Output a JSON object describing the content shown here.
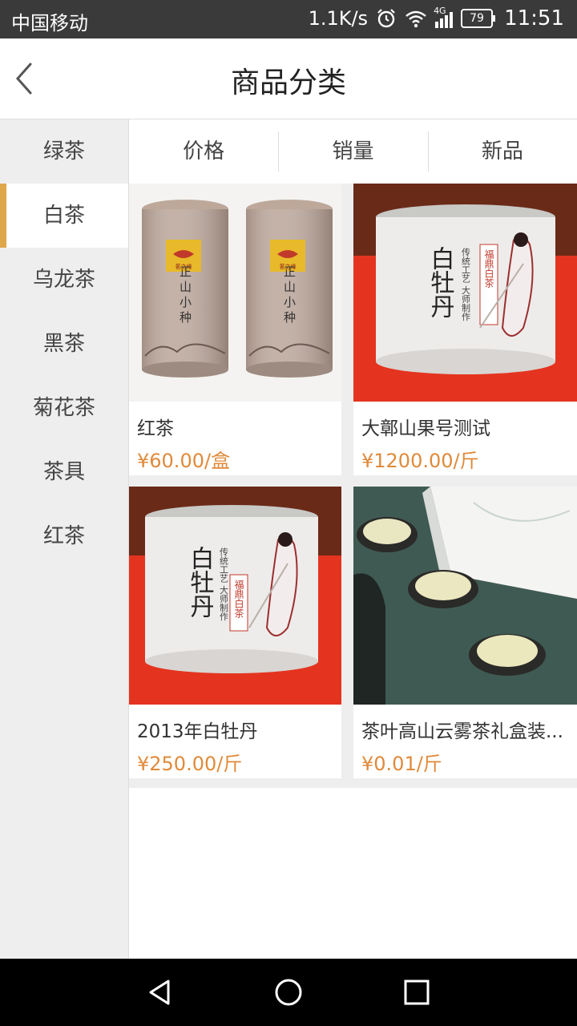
{
  "status_bar": {
    "carrier": "中国移动",
    "speed": "1.1K/s",
    "network": "4G",
    "battery": "79",
    "time": "11:51"
  },
  "header": {
    "title": "商品分类"
  },
  "sidebar": {
    "items": [
      {
        "label": "绿茶"
      },
      {
        "label": "白茶"
      },
      {
        "label": "乌龙茶"
      },
      {
        "label": "黑茶"
      },
      {
        "label": "菊花茶"
      },
      {
        "label": "茶具"
      },
      {
        "label": "红茶"
      }
    ],
    "active": "白茶"
  },
  "sort_tabs": [
    {
      "label": "价格"
    },
    {
      "label": "销量"
    },
    {
      "label": "新品"
    }
  ],
  "products": [
    {
      "name": "红茶",
      "price": "¥60.00/盒",
      "image": "tea-tin-pair-image",
      "tin_text": "正山小种",
      "brand": "茗之缘"
    },
    {
      "name": "大鄣山果号测试",
      "price": "¥1200.00/斤",
      "image": "white-peony-tin-image",
      "tin_text": "白牡丹",
      "tin_sub": "传统工艺 大师制作",
      "tin_tag": "福鼎白茶"
    },
    {
      "name": "2013年白牡丹",
      "price": "¥250.00/斤",
      "image": "white-peony-tin-image",
      "tin_text": "白牡丹",
      "tin_sub": "传统工艺 大师制作",
      "tin_tag": "福鼎白茶"
    },
    {
      "name": "茶叶高山云雾茶礼盒装...",
      "price": "¥0.01/斤",
      "image": "tea-cups-gift-box-image"
    }
  ],
  "colors": {
    "accent": "#e0a64a",
    "price": "#e08a3a",
    "status_bar": "#3a3a3a",
    "sidebar_bg": "#eeeeee"
  }
}
